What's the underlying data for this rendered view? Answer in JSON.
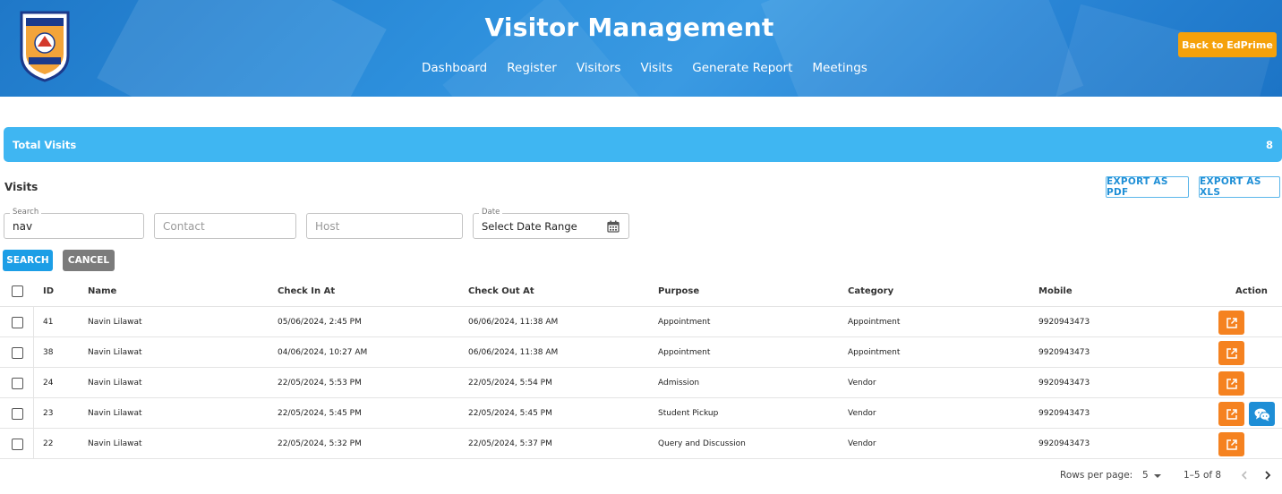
{
  "header": {
    "title": "Visitor Management",
    "nav": [
      "Dashboard",
      "Register",
      "Visitors",
      "Visits",
      "Generate Report",
      "Meetings"
    ],
    "back_button": "Back to EdPrime",
    "brand_color": "#2a86d6",
    "back_color": "#f5a10a"
  },
  "summary": {
    "label": "Total Visits",
    "value": "8",
    "color": "#3fb6f2"
  },
  "visits": {
    "title": "Visits",
    "export_pdf": "EXPORT AS PDF",
    "export_xls": "EXPORT AS XLS"
  },
  "filters": {
    "search_label": "Search",
    "search_value": "nav",
    "contact_placeholder": "Contact",
    "host_placeholder": "Host",
    "date_label": "Date",
    "date_value": "Select Date Range",
    "search_button": "SEARCH",
    "cancel_button": "CANCEL"
  },
  "table": {
    "columns": [
      "ID",
      "Name",
      "Check In At",
      "Check Out At",
      "Purpose",
      "Category",
      "Mobile",
      "Action"
    ],
    "rows": [
      {
        "id": "41",
        "name": "Navin Lilawat",
        "check_in": "05/06/2024, 2:45 PM",
        "check_out": "06/06/2024, 11:38 AM",
        "purpose": "Appointment",
        "category": "Appointment",
        "mobile": "9920943473",
        "chat": false
      },
      {
        "id": "38",
        "name": "Navin Lilawat",
        "check_in": "04/06/2024, 10:27 AM",
        "check_out": "06/06/2024, 11:38 AM",
        "purpose": "Appointment",
        "category": "Appointment",
        "mobile": "9920943473",
        "chat": false
      },
      {
        "id": "24",
        "name": "Navin Lilawat",
        "check_in": "22/05/2024, 5:53 PM",
        "check_out": "22/05/2024, 5:54 PM",
        "purpose": "Admission",
        "category": "Vendor",
        "mobile": "9920943473",
        "chat": false
      },
      {
        "id": "23",
        "name": "Navin Lilawat",
        "check_in": "22/05/2024, 5:45 PM",
        "check_out": "22/05/2024, 5:45 PM",
        "purpose": "Student Pickup",
        "category": "Vendor",
        "mobile": "9920943473",
        "chat": true
      },
      {
        "id": "22",
        "name": "Navin Lilawat",
        "check_in": "22/05/2024, 5:32 PM",
        "check_out": "22/05/2024, 5:37 PM",
        "purpose": "Query and Discussion",
        "category": "Vendor",
        "mobile": "9920943473",
        "chat": false
      }
    ],
    "action_icons": {
      "edit": "open-in-new-icon",
      "chat": "chat-icon"
    },
    "edit_color": "#f58220",
    "chat_color": "#1e8ed6"
  },
  "pagination": {
    "rows_per_page_label": "Rows per page:",
    "rows_per_page": "5",
    "range": "1–5 of 8"
  }
}
